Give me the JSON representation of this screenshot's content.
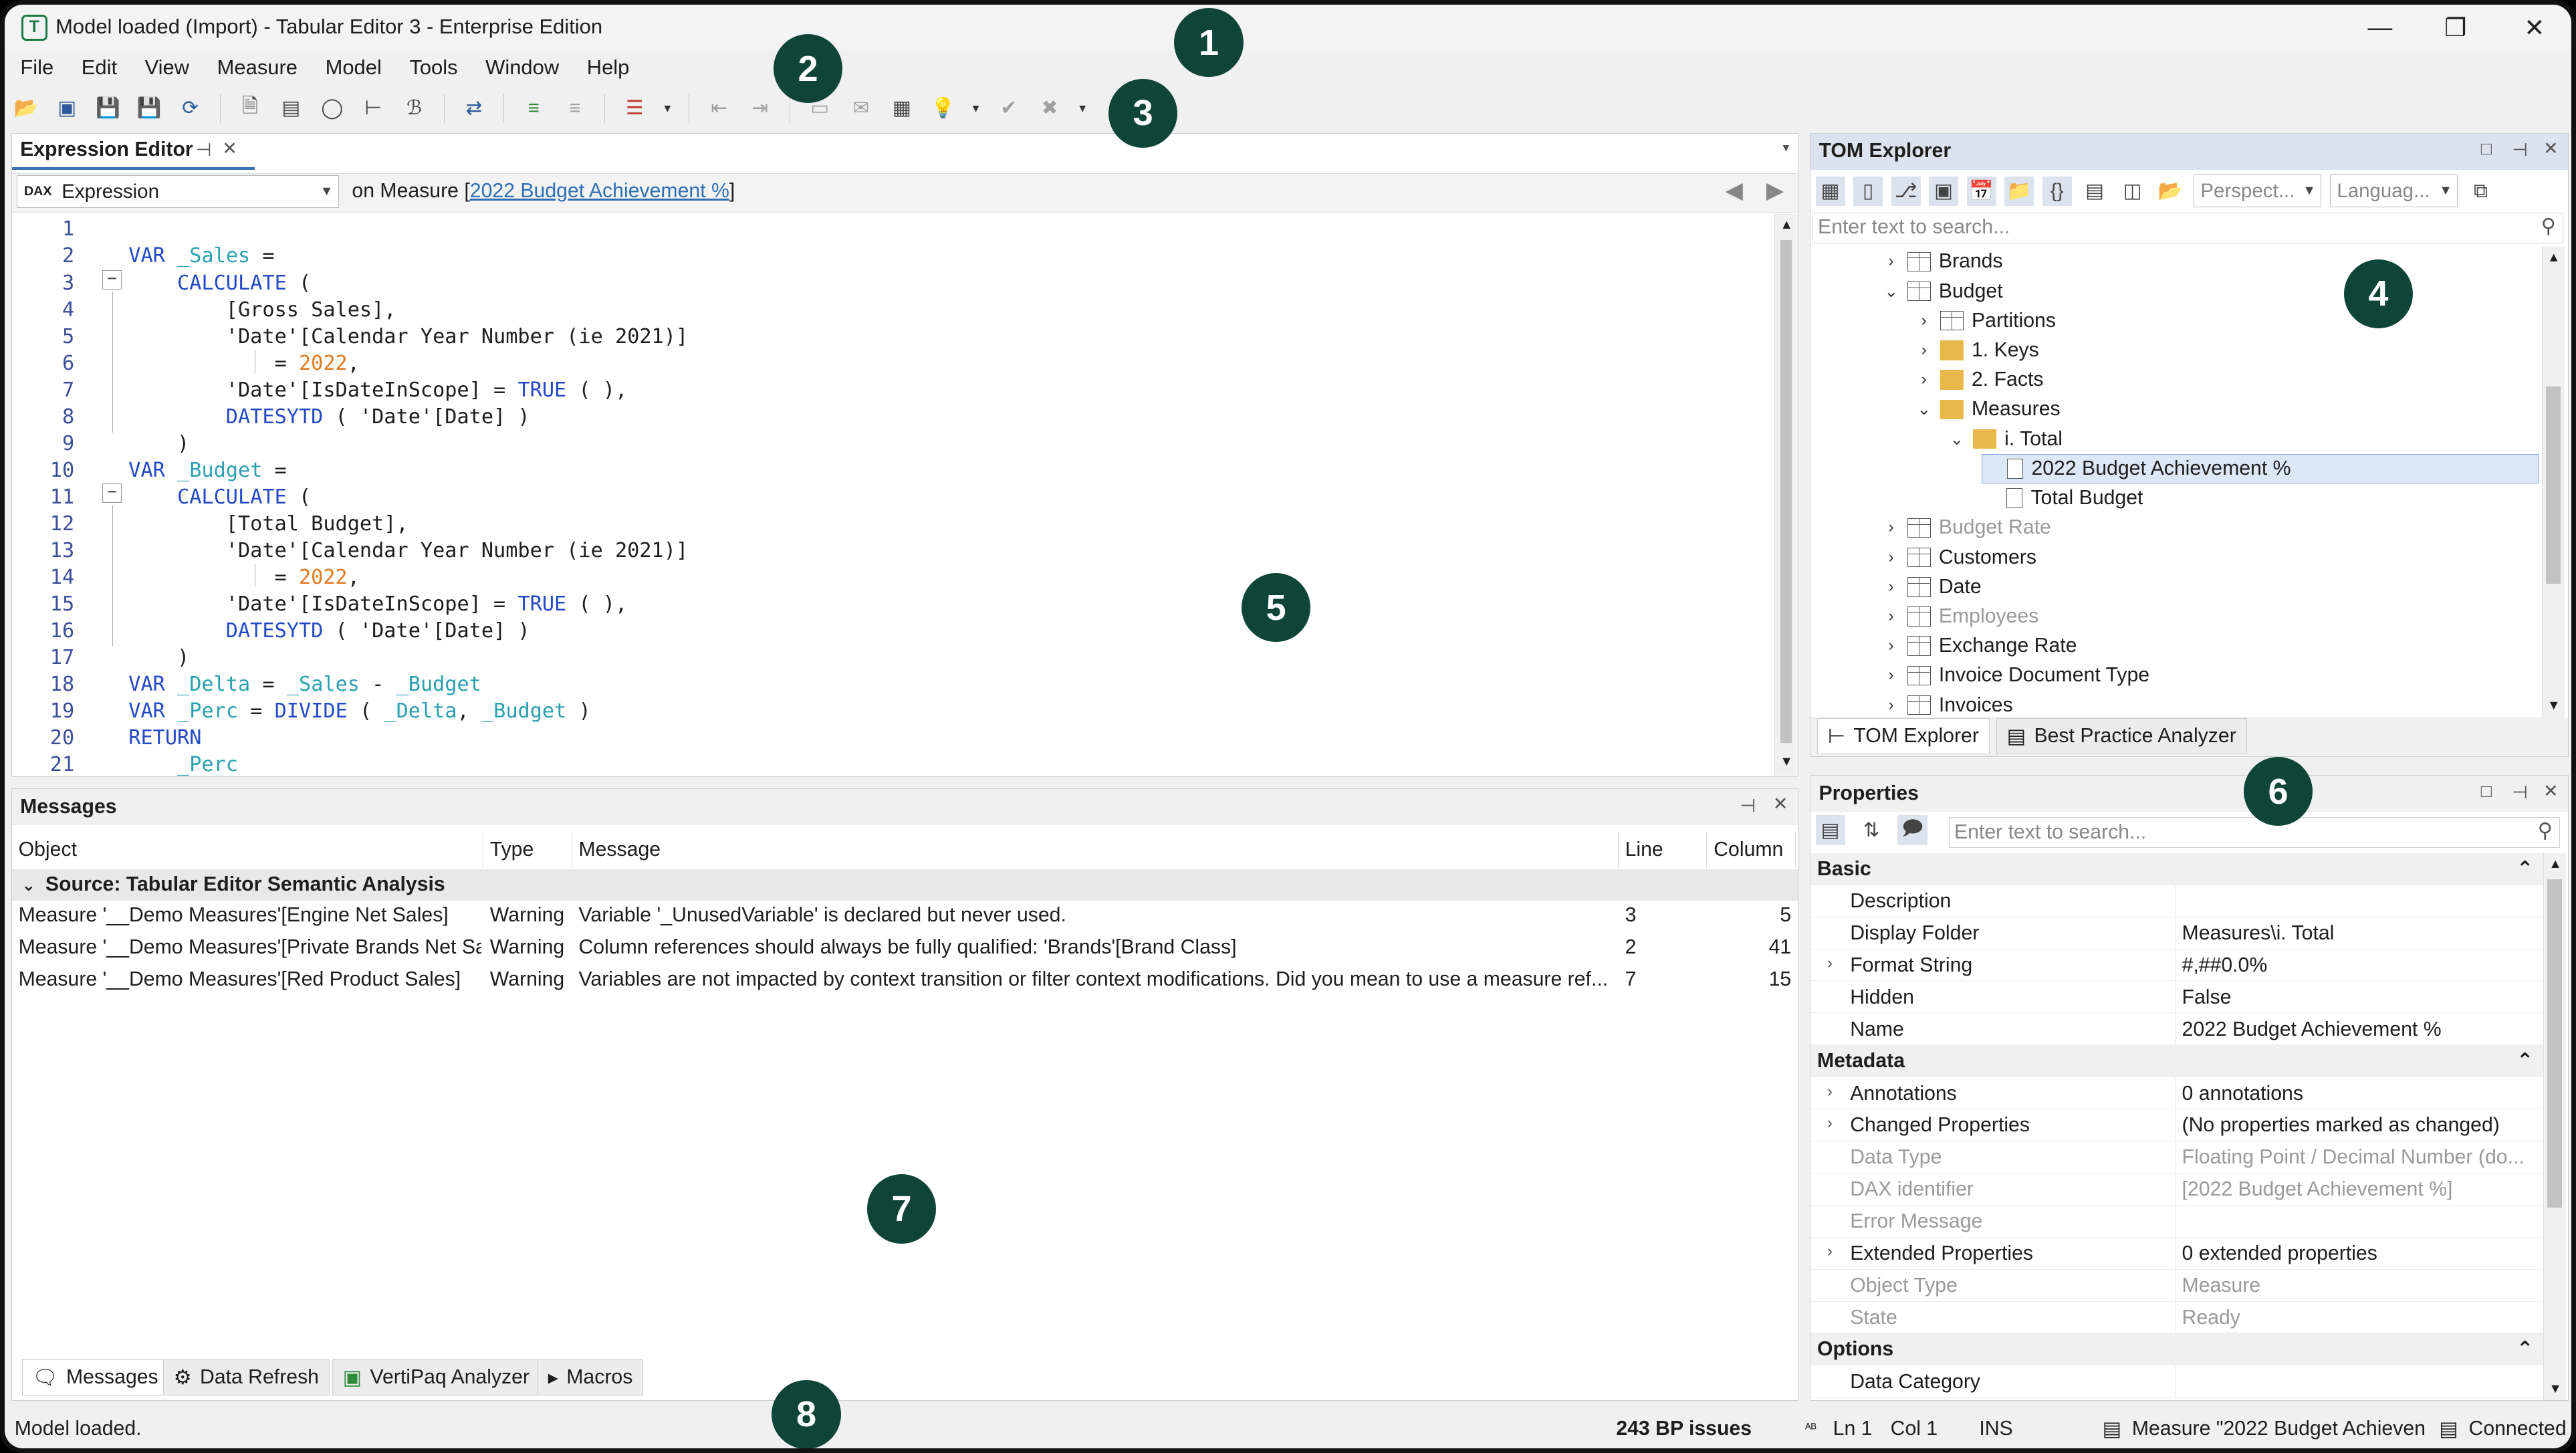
{
  "window": {
    "title": "Model loaded (Import) - Tabular Editor 3 - Enterprise Edition",
    "app_icon": "T",
    "minimize": "—",
    "restore": "❐",
    "close": "✕"
  },
  "menu": [
    "File",
    "Edit",
    "View",
    "Measure",
    "Model",
    "Tools",
    "Window",
    "Help"
  ],
  "toolbar_icons": [
    "open-icon",
    "deploy-icon",
    "save-icon",
    "save-all-icon",
    "refresh-icon",
    "new-document-icon",
    "query-icon",
    "pivot-icon",
    "diagram-icon",
    "script-icon",
    "compare-icon",
    "format-icon",
    "unformat-icon",
    "dax-format-icon",
    "indent-icon",
    "outdent-icon",
    "comment-icon",
    "uncomment-icon",
    "window-icon",
    "lightbulb-icon",
    "check-icon",
    "cancel-icon"
  ],
  "expression_editor": {
    "tab_label": "Expression Editor",
    "combo_badge": "DAX",
    "combo_value": "Expression",
    "context_prefix": "on Measure [",
    "context_link": "2022 Budget Achievement %",
    "context_suffix": "]",
    "line_numbers": [
      "1",
      "2",
      "3",
      "4",
      "5",
      "6",
      "7",
      "8",
      "9",
      "10",
      "11",
      "12",
      "13",
      "14",
      "15",
      "16",
      "17",
      "18",
      "19",
      "20",
      "21"
    ]
  },
  "tom_explorer": {
    "title": "TOM Explorer",
    "perspective_placeholder": "Perspect...",
    "language_placeholder": "Languag...",
    "search_placeholder": "Enter text to search...",
    "tree": [
      {
        "label": "Brands",
        "icon": "table-icon",
        "level": 0,
        "chevron": "›"
      },
      {
        "label": "Budget",
        "icon": "table-icon",
        "level": 0,
        "chevron": "⌄"
      },
      {
        "label": "Partitions",
        "icon": "partition-icon",
        "level": 1,
        "chevron": "›"
      },
      {
        "label": "1. Keys",
        "icon": "folder-icon",
        "level": 1,
        "chevron": "›"
      },
      {
        "label": "2. Facts",
        "icon": "folder-icon",
        "level": 1,
        "chevron": "›"
      },
      {
        "label": "Measures",
        "icon": "folder-icon",
        "level": 1,
        "chevron": "⌄"
      },
      {
        "label": "i. Total",
        "icon": "folder-icon",
        "level": 2,
        "chevron": "⌄"
      },
      {
        "label": "2022 Budget Achievement %",
        "icon": "measure-icon",
        "level": 3,
        "chevron": "",
        "selected": true
      },
      {
        "label": "Total Budget",
        "icon": "measure-icon",
        "level": 3,
        "chevron": ""
      },
      {
        "label": "Budget Rate",
        "icon": "table-icon",
        "level": 0,
        "chevron": "›",
        "dim": true
      },
      {
        "label": "Customers",
        "icon": "table-icon",
        "level": 0,
        "chevron": "›"
      },
      {
        "label": "Date",
        "icon": "calendar-table-icon",
        "level": 0,
        "chevron": "›"
      },
      {
        "label": "Employees",
        "icon": "table-icon",
        "level": 0,
        "chevron": "›",
        "dim": true
      },
      {
        "label": "Exchange Rate",
        "icon": "table-icon",
        "level": 0,
        "chevron": "›"
      },
      {
        "label": "Invoice Document Type",
        "icon": "table-icon",
        "level": 0,
        "chevron": "›"
      },
      {
        "label": "Invoices",
        "icon": "table-icon",
        "level": 0,
        "chevron": "›"
      }
    ],
    "tabs": [
      "TOM Explorer",
      "Best Practice Analyzer"
    ]
  },
  "properties": {
    "title": "Properties",
    "search_placeholder": "Enter text to search...",
    "categories": [
      {
        "name": "Basic",
        "rows": [
          {
            "key": "Description",
            "value": "",
            "expandable": false,
            "dim": false
          },
          {
            "key": "Display Folder",
            "value": "Measures\\i. Total",
            "expandable": false,
            "dim": false
          },
          {
            "key": "Format String",
            "value": "#,##0.0%",
            "expandable": true,
            "dim": false
          },
          {
            "key": "Hidden",
            "value": "False",
            "expandable": false,
            "dim": false
          },
          {
            "key": "Name",
            "value": "2022 Budget Achievement %",
            "expandable": false,
            "dim": false
          }
        ]
      },
      {
        "name": "Metadata",
        "rows": [
          {
            "key": "Annotations",
            "value": "0 annotations",
            "expandable": true,
            "dim": false
          },
          {
            "key": "Changed Properties",
            "value": "(No properties marked as changed)",
            "expandable": true,
            "dim": false
          },
          {
            "key": "Data Type",
            "value": "Floating Point / Decimal Number (do...",
            "expandable": false,
            "dim": true
          },
          {
            "key": "DAX identifier",
            "value": "[2022 Budget Achievement %]",
            "expandable": false,
            "dim": true
          },
          {
            "key": "Error Message",
            "value": "",
            "expandable": false,
            "dim": true
          },
          {
            "key": "Extended Properties",
            "value": "0 extended properties",
            "expandable": true,
            "dim": false
          },
          {
            "key": "Object Type",
            "value": "Measure",
            "expandable": false,
            "dim": true
          },
          {
            "key": "State",
            "value": "Ready",
            "expandable": false,
            "dim": true
          }
        ]
      },
      {
        "name": "Options",
        "rows": [
          {
            "key": "Data Category",
            "value": "",
            "expandable": false,
            "dim": false
          }
        ]
      }
    ]
  },
  "messages": {
    "title": "Messages",
    "columns": [
      "Object",
      "Type",
      "Message",
      "Line",
      "Column"
    ],
    "group": "Source: Tabular Editor Semantic Analysis",
    "rows": [
      {
        "object": "Measure '__Demo Measures'[Engine Net Sales]",
        "type": "Warning",
        "message": "Variable '_UnusedVariable' is declared but never used.",
        "line": "3",
        "column": "5"
      },
      {
        "object": "Measure '__Demo Measures'[Private Brands Net Sa...",
        "type": "Warning",
        "message": "Column references should always be fully qualified: 'Brands'[Brand Class]",
        "line": "2",
        "column": "41"
      },
      {
        "object": "Measure '__Demo Measures'[Red Product Sales]",
        "type": "Warning",
        "message": "Variables are not impacted by context transition or filter context modifications. Did you mean to use a measure ref...",
        "line": "7",
        "column": "15"
      }
    ],
    "tabs": [
      "Messages",
      "Data Refresh",
      "VertiPaq Analyzer",
      "Macros"
    ]
  },
  "status": {
    "left": "Model loaded.",
    "bp_issues": "243 BP issues",
    "ln": "Ln 1",
    "col": "Col 1",
    "ins": "INS",
    "object": "Measure \"2022 Budget Achieven",
    "connection": "Connected"
  },
  "callouts": [
    "1",
    "2",
    "3",
    "4",
    "5",
    "6",
    "7",
    "8"
  ],
  "colors": {
    "accent": "#3b73b9",
    "keyword": "#2349c5",
    "variable": "#2aa0b0",
    "number": "#e07a1f",
    "callout": "#0f4537"
  }
}
